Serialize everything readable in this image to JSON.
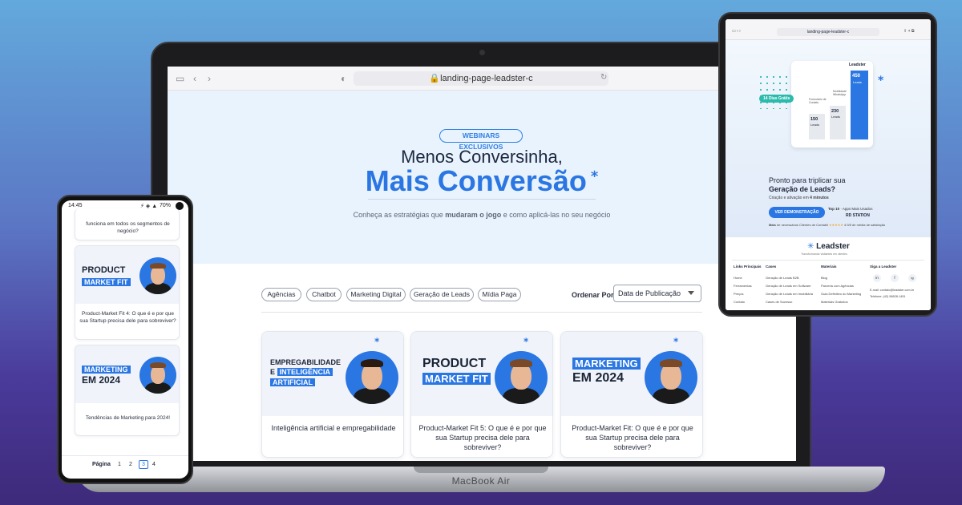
{
  "laptop": {
    "device_label": "MacBook Air",
    "url": "landing-page-leadster-c",
    "hero": {
      "badge": "WEBINARS EXCLUSIVOS",
      "title_line1": "Menos Conversinha,",
      "title_line2": "Mais Conversão",
      "subtitle_pre": "Conheça as estratégias que ",
      "subtitle_bold1": "mudaram o jogo",
      "subtitle_mid": " e como aplicá-las no seu negócio"
    },
    "filters": [
      "Agências",
      "Chatbot",
      "Marketing Digital",
      "Geração de Leads",
      "Mídia Paga"
    ],
    "order_label": "Ordenar Por",
    "order_value": "Data de Publicação",
    "cards": [
      {
        "thumb_line1": "EMPREGABILIDADE",
        "thumb_e": "E",
        "thumb_box1": "INTELIGÊNCIA",
        "thumb_box2": "ARTIFICIAL",
        "title": "Inteligência artificial e empregabilidade"
      },
      {
        "thumb_line1": "PRODUCT",
        "thumb_box1": "MARKET FIT",
        "title": "Product-Market Fit 5: O que é e por que sua Startup precisa dele para sobreviver?"
      },
      {
        "thumb_box1": "MARKETING",
        "thumb_line1": "EM 2024",
        "title": "Product-Market Fit: O que é e por que sua Startup precisa dele para sobreviver?"
      }
    ]
  },
  "phone": {
    "time": "14:45",
    "battery": "70%",
    "top_card_title": "funciona em todos os segmentos de negócio?",
    "cards": [
      {
        "thumb_line1": "PRODUCT",
        "thumb_box1": "MARKET FIT",
        "title": "Product-Market Fit 4: O que é e por que sua Startup precisa dele para sobreviver?"
      },
      {
        "thumb_box1": "MARKETING",
        "thumb_line1": "EM 2024",
        "title": "Tendências de Marketing para 2024!"
      }
    ],
    "pagination": {
      "label": "Página",
      "pages": [
        "1",
        "2",
        "3",
        "4"
      ],
      "current": "3"
    }
  },
  "tablet": {
    "url": "landing-page-leadster-c",
    "brand": "Leadster",
    "tagline": "Transformando visitantes em clientes",
    "chart": {
      "bar_labels": [
        "150",
        "230",
        "450"
      ],
      "bar_captions": [
        "Leads",
        "Leads",
        "Leads"
      ],
      "pill": "14 Dias Grátis",
      "legend1": "Formulário de Contato",
      "legend2": "Mobilidade WhatsApp",
      "values": [
        150,
        230,
        450
      ]
    },
    "cta": {
      "line1": "Pronto para triplicar sua",
      "line2": "Geração de Leads?",
      "sub_pre": "Criação e ativação em ",
      "sub_bold": "4 minutos",
      "button": "VER DEMONSTRAÇÃO",
      "top10": "Top 10",
      "top10_rest": " · Apps Mais Usados",
      "partner": "RD STATION",
      "rating_pre": "Mais",
      "rating_text": " de necessários Clientes de Contabil",
      "stars": "★★★★★",
      "rating_after": "4.9/5 de média de satisfação"
    },
    "footer": {
      "cols": [
        {
          "title": "Links Principais",
          "items": [
            "Home",
            "Ferramentas",
            "Preços",
            "Contato"
          ]
        },
        {
          "title": "Cases",
          "items": [
            "Geração de Leads B2B",
            "Geração de Leads em Software",
            "Geração de Leads em Imobiliária",
            "Cases de Sucesso"
          ]
        },
        {
          "title": "Materiais",
          "items": [
            "Blog",
            "Parceria com Agências",
            "Guia Definitivo do Marketing",
            "Materiais Gratuitos"
          ]
        },
        {
          "title": "Siga a Leadster",
          "items": [
            "E-mail: contato@leadster.com.br",
            "Telefone: (42) 98828-1451"
          ]
        }
      ],
      "social": [
        "in",
        "f",
        "ig"
      ]
    }
  },
  "colors": {
    "brand_blue": "#2a76e2",
    "hero_bg": "#e9f3fd",
    "text_dark": "#1b2436"
  }
}
